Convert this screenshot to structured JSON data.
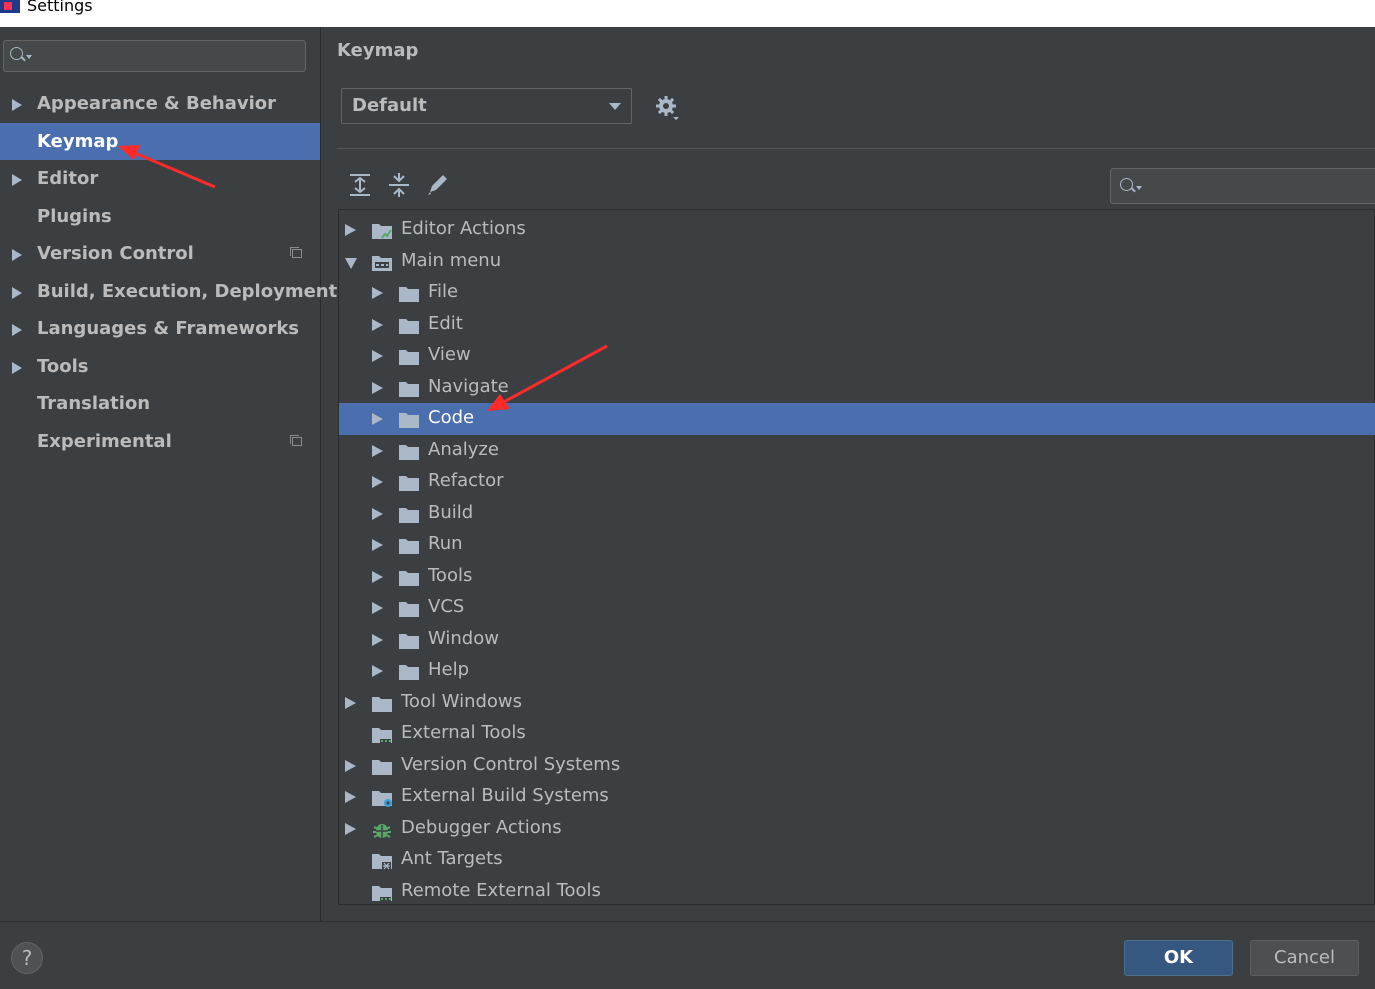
{
  "window": {
    "title": "Settings"
  },
  "sidebar": {
    "search_placeholder": "",
    "items": [
      {
        "label": "Appearance & Behavior",
        "expandable": true,
        "selected": false,
        "project_icon": false
      },
      {
        "label": "Keymap",
        "expandable": false,
        "selected": true,
        "project_icon": false
      },
      {
        "label": "Editor",
        "expandable": true,
        "selected": false,
        "project_icon": false
      },
      {
        "label": "Plugins",
        "expandable": false,
        "selected": false,
        "project_icon": false
      },
      {
        "label": "Version Control",
        "expandable": true,
        "selected": false,
        "project_icon": true
      },
      {
        "label": "Build, Execution, Deployment",
        "expandable": true,
        "selected": false,
        "project_icon": false
      },
      {
        "label": "Languages & Frameworks",
        "expandable": true,
        "selected": false,
        "project_icon": false
      },
      {
        "label": "Tools",
        "expandable": true,
        "selected": false,
        "project_icon": false
      },
      {
        "label": "Translation",
        "expandable": false,
        "selected": false,
        "project_icon": false
      },
      {
        "label": "Experimental",
        "expandable": false,
        "selected": false,
        "project_icon": true
      }
    ]
  },
  "main": {
    "title": "Keymap",
    "keymap_select": {
      "value": "Default"
    },
    "toolbar_icons": [
      "expand-all-icon",
      "collapse-all-icon",
      "edit-shortcut-icon"
    ],
    "filter_placeholder": "",
    "tree": [
      {
        "label": "Editor Actions",
        "level": 0,
        "state": "collapsed",
        "icon": "editor-actions-icon"
      },
      {
        "label": "Main menu",
        "level": 0,
        "state": "expanded",
        "icon": "main-menu-icon"
      },
      {
        "label": "File",
        "level": 1,
        "state": "collapsed",
        "icon": "folder-icon"
      },
      {
        "label": "Edit",
        "level": 1,
        "state": "collapsed",
        "icon": "folder-icon"
      },
      {
        "label": "View",
        "level": 1,
        "state": "collapsed",
        "icon": "folder-icon"
      },
      {
        "label": "Navigate",
        "level": 1,
        "state": "collapsed",
        "icon": "folder-icon"
      },
      {
        "label": "Code",
        "level": 1,
        "state": "collapsed",
        "icon": "folder-icon",
        "selected": true
      },
      {
        "label": "Analyze",
        "level": 1,
        "state": "collapsed",
        "icon": "folder-icon"
      },
      {
        "label": "Refactor",
        "level": 1,
        "state": "collapsed",
        "icon": "folder-icon"
      },
      {
        "label": "Build",
        "level": 1,
        "state": "collapsed",
        "icon": "folder-icon"
      },
      {
        "label": "Run",
        "level": 1,
        "state": "collapsed",
        "icon": "folder-icon"
      },
      {
        "label": "Tools",
        "level": 1,
        "state": "collapsed",
        "icon": "folder-icon"
      },
      {
        "label": "VCS",
        "level": 1,
        "state": "collapsed",
        "icon": "folder-icon"
      },
      {
        "label": "Window",
        "level": 1,
        "state": "collapsed",
        "icon": "folder-icon"
      },
      {
        "label": "Help",
        "level": 1,
        "state": "collapsed",
        "icon": "folder-icon"
      },
      {
        "label": "Tool Windows",
        "level": 0,
        "state": "collapsed",
        "icon": "folder-icon"
      },
      {
        "label": "External Tools",
        "level": 0,
        "state": "leaf",
        "icon": "external-tools-icon"
      },
      {
        "label": "Version Control Systems",
        "level": 0,
        "state": "collapsed",
        "icon": "folder-icon"
      },
      {
        "label": "External Build Systems",
        "level": 0,
        "state": "collapsed",
        "icon": "external-build-systems-icon"
      },
      {
        "label": "Debugger Actions",
        "level": 0,
        "state": "collapsed",
        "icon": "bug-icon"
      },
      {
        "label": "Ant Targets",
        "level": 0,
        "state": "leaf",
        "icon": "ant-targets-icon"
      },
      {
        "label": "Remote External Tools",
        "level": 0,
        "state": "leaf",
        "icon": "remote-external-tools-icon"
      }
    ]
  },
  "footer": {
    "help_label": "?",
    "ok_label": "OK",
    "cancel_label": "Cancel"
  },
  "colors": {
    "background": "#3c3f41",
    "selection": "#4b6eaf",
    "text": "#bbbbbb",
    "folder": "#a9b7c6",
    "ok_button": "#365880",
    "annotation_arrow": "#ff2a2a"
  }
}
